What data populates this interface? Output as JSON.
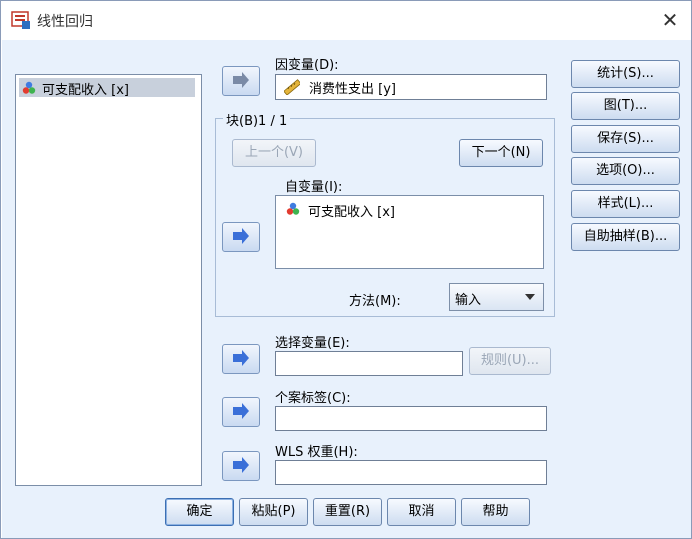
{
  "window": {
    "title": "线性回归",
    "close_glyph": "✕"
  },
  "source_list": {
    "items": [
      {
        "label": "可支配收入 [x]",
        "icon": "scale-variable-icon",
        "selected": true
      }
    ]
  },
  "dependent": {
    "label": "因变量(D):",
    "value": "消费性支出 [y]",
    "icon": "ruler-variable-icon"
  },
  "block": {
    "title": "块(B)1 / 1",
    "prev_label": "上一个(V)",
    "next_label": "下一个(N)"
  },
  "independent": {
    "label": "自变量(I):",
    "items": [
      {
        "label": "可支配收入 [x]",
        "icon": "scale-variable-icon"
      }
    ]
  },
  "method": {
    "label": "方法(M):",
    "value": "输入"
  },
  "selection": {
    "label": "选择变量(E):",
    "value": "",
    "rule_label": "规则(U)..."
  },
  "case_labels": {
    "label": "个案标签(C):",
    "value": ""
  },
  "wls": {
    "label": "WLS 权重(H):",
    "value": ""
  },
  "side_buttons": [
    {
      "label": "统计(S)...",
      "name": "statistics-button"
    },
    {
      "label": "图(T)...",
      "name": "plots-button"
    },
    {
      "label": "保存(S)...",
      "name": "save-button"
    },
    {
      "label": "选项(O)...",
      "name": "options-button"
    },
    {
      "label": "样式(L)...",
      "name": "style-button"
    },
    {
      "label": "自助抽样(B)...",
      "name": "bootstrap-button"
    }
  ],
  "bottom_buttons": [
    {
      "label": "确定",
      "name": "ok-button"
    },
    {
      "label": "粘贴(P)",
      "name": "paste-button"
    },
    {
      "label": "重置(R)",
      "name": "reset-button"
    },
    {
      "label": "取消",
      "name": "cancel-button"
    },
    {
      "label": "帮助",
      "name": "help-button"
    }
  ],
  "colors": {
    "accent": "#3c6fb3",
    "arrow": "#3a6fd8",
    "client_bg": "#e8f1fc"
  }
}
